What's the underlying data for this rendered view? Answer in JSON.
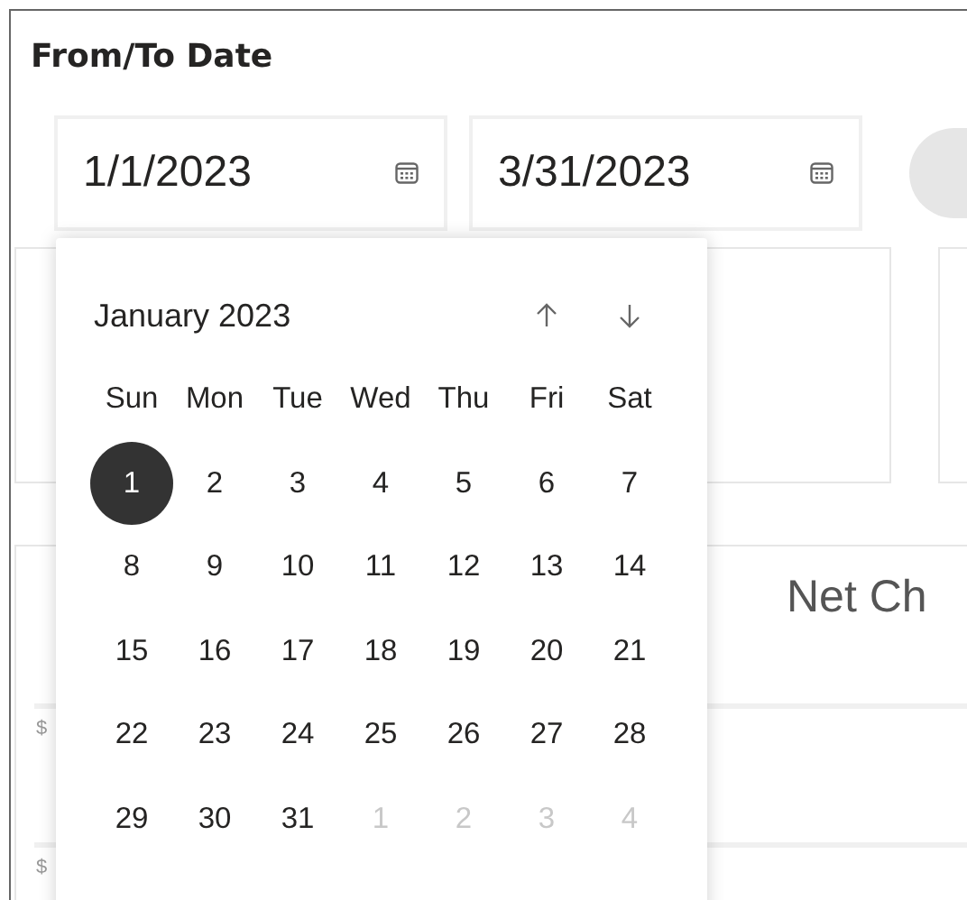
{
  "title": "From/To Date",
  "date_fields": [
    {
      "value": "1/1/2023"
    },
    {
      "value": "3/31/2023"
    }
  ],
  "calendar": {
    "month_label": "January 2023",
    "weekdays": [
      "Sun",
      "Mon",
      "Tue",
      "Wed",
      "Thu",
      "Fri",
      "Sat"
    ],
    "weeks": [
      [
        {
          "day": "1",
          "in_month": true,
          "selected": true
        },
        {
          "day": "2",
          "in_month": true,
          "selected": false
        },
        {
          "day": "3",
          "in_month": true,
          "selected": false
        },
        {
          "day": "4",
          "in_month": true,
          "selected": false
        },
        {
          "day": "5",
          "in_month": true,
          "selected": false
        },
        {
          "day": "6",
          "in_month": true,
          "selected": false
        },
        {
          "day": "7",
          "in_month": true,
          "selected": false
        }
      ],
      [
        {
          "day": "8",
          "in_month": true,
          "selected": false
        },
        {
          "day": "9",
          "in_month": true,
          "selected": false
        },
        {
          "day": "10",
          "in_month": true,
          "selected": false
        },
        {
          "day": "11",
          "in_month": true,
          "selected": false
        },
        {
          "day": "12",
          "in_month": true,
          "selected": false
        },
        {
          "day": "13",
          "in_month": true,
          "selected": false
        },
        {
          "day": "14",
          "in_month": true,
          "selected": false
        }
      ],
      [
        {
          "day": "15",
          "in_month": true,
          "selected": false
        },
        {
          "day": "16",
          "in_month": true,
          "selected": false
        },
        {
          "day": "17",
          "in_month": true,
          "selected": false
        },
        {
          "day": "18",
          "in_month": true,
          "selected": false
        },
        {
          "day": "19",
          "in_month": true,
          "selected": false
        },
        {
          "day": "20",
          "in_month": true,
          "selected": false
        },
        {
          "day": "21",
          "in_month": true,
          "selected": false
        }
      ],
      [
        {
          "day": "22",
          "in_month": true,
          "selected": false
        },
        {
          "day": "23",
          "in_month": true,
          "selected": false
        },
        {
          "day": "24",
          "in_month": true,
          "selected": false
        },
        {
          "day": "25",
          "in_month": true,
          "selected": false
        },
        {
          "day": "26",
          "in_month": true,
          "selected": false
        },
        {
          "day": "27",
          "in_month": true,
          "selected": false
        },
        {
          "day": "28",
          "in_month": true,
          "selected": false
        }
      ],
      [
        {
          "day": "29",
          "in_month": true,
          "selected": false
        },
        {
          "day": "30",
          "in_month": true,
          "selected": false
        },
        {
          "day": "31",
          "in_month": true,
          "selected": false
        },
        {
          "day": "1",
          "in_month": false,
          "selected": false
        },
        {
          "day": "2",
          "in_month": false,
          "selected": false
        },
        {
          "day": "3",
          "in_month": false,
          "selected": false
        },
        {
          "day": "4",
          "in_month": false,
          "selected": false
        }
      ]
    ]
  },
  "chart": {
    "title": "Net Ch",
    "axis_labels": [
      "$",
      "$"
    ]
  }
}
